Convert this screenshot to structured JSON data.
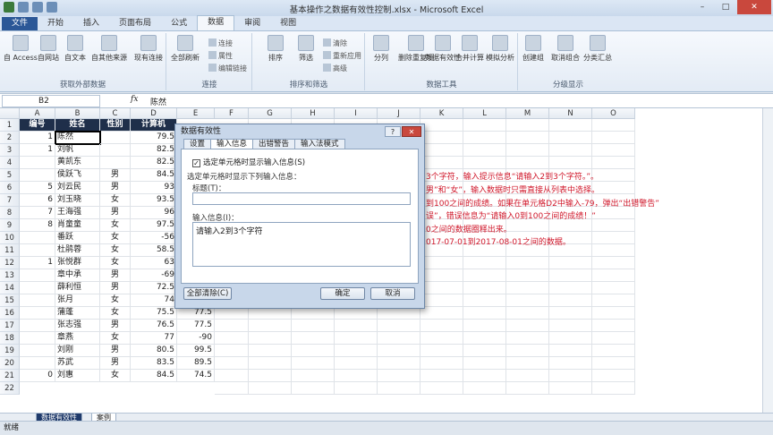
{
  "window": {
    "title": "基本操作之数据有效性控制.xlsx - Microsoft Excel",
    "min": "–",
    "max": "□",
    "close": "✕"
  },
  "tabs": [
    "文件",
    "开始",
    "插入",
    "页面布局",
    "公式",
    "数据",
    "审阅",
    "视图"
  ],
  "ribbon": {
    "groups": [
      {
        "label": "获取外部数据",
        "buttons": [
          "自 Access",
          "自网站",
          "自文本",
          "自其他来源",
          "现有连接"
        ]
      },
      {
        "label": "连接",
        "buttons": [
          "全部刷新"
        ],
        "small": [
          "连接",
          "属性",
          "编辑链接"
        ]
      },
      {
        "label": "排序和筛选",
        "buttons": [
          "排序",
          "筛选"
        ],
        "small": [
          "清除",
          "重新应用",
          "高级"
        ]
      },
      {
        "label": "数据工具",
        "buttons": [
          "分列",
          "删除重复项",
          "数据有效性",
          "合并计算",
          "模拟分析"
        ]
      },
      {
        "label": "分级显示",
        "buttons": [
          "创建组",
          "取消组合",
          "分类汇总"
        ]
      }
    ]
  },
  "formula_bar": {
    "name_box": "B2",
    "fx": "fx",
    "value": "陈然"
  },
  "columns": [
    "A",
    "B",
    "C",
    "D",
    "E",
    "F",
    "G",
    "H",
    "I",
    "J",
    "K",
    "L",
    "M",
    "N",
    "O"
  ],
  "header_row": [
    "编号",
    "姓名",
    "性别",
    "计算机"
  ],
  "rows": [
    {
      "n": "1",
      "name": "陈然",
      "sex": "",
      "score": "79.5",
      "e": ""
    },
    {
      "n": "1",
      "name": "刘帆",
      "sex": "",
      "score": "82.5",
      "e": ""
    },
    {
      "n": "",
      "name": "黄凯东",
      "sex": "",
      "score": "82.5",
      "e": ""
    },
    {
      "n": "",
      "name": "侯跃飞",
      "sex": "男",
      "score": "84.5",
      "e": ""
    },
    {
      "n": "5",
      "name": "刘云民",
      "sex": "男",
      "score": "93",
      "e": ""
    },
    {
      "n": "6",
      "name": "刘玉晓",
      "sex": "女",
      "score": "93.5",
      "e": ""
    },
    {
      "n": "7",
      "name": "王海强",
      "sex": "男",
      "score": "96",
      "e": ""
    },
    {
      "n": "8",
      "name": "肖童童",
      "sex": "女",
      "score": "97.5",
      "e": ""
    },
    {
      "n": "",
      "name": "番跃",
      "sex": "女",
      "score": "-56",
      "e": ""
    },
    {
      "n": "",
      "name": "杜鹃蓉",
      "sex": "女",
      "score": "58.5",
      "e": ""
    },
    {
      "n": "1",
      "name": "张悦群",
      "sex": "女",
      "score": "63",
      "e": ""
    },
    {
      "n": "",
      "name": "章中承",
      "sex": "男",
      "score": "-69",
      "e": ""
    },
    {
      "n": "",
      "name": "薛利恒",
      "sex": "男",
      "score": "72.5",
      "e": ""
    },
    {
      "n": "",
      "name": "张月",
      "sex": "女",
      "score": "74",
      "e": ""
    },
    {
      "n": "",
      "name": "蒲蓬",
      "sex": "女",
      "score": "75.5",
      "e": "77.5"
    },
    {
      "n": "",
      "name": "张志强",
      "sex": "男",
      "score": "76.5",
      "e": "77.5"
    },
    {
      "n": "",
      "name": "章燕",
      "sex": "女",
      "score": "77",
      "e": "-90"
    },
    {
      "n": "",
      "name": "刘刚",
      "sex": "男",
      "score": "80.5",
      "e": "99.5"
    },
    {
      "n": "",
      "name": "苏武",
      "sex": "男",
      "score": "83.5",
      "e": "89.5"
    },
    {
      "n": "0",
      "name": "刘惠",
      "sex": "女",
      "score": "84.5",
      "e": "74.5"
    }
  ],
  "instructions": [
    "3个字符，输入提示信息“请输入2到3个字符。”。",
    "男”和“女”，输入数据时只需直接从列表中选择。",
    "到100之间的成绩。如果在单元格D2中输入-79，弹出“出错警告”",
    "误”，错误信息为“请输入0到100之间的成绩！”",
    "0之间的数据圈释出来。",
    "017-07-01到2017-08-01之间的数据。"
  ],
  "dialog": {
    "title": "数据有效性",
    "help": "?",
    "close": "✕",
    "tabs": [
      "设置",
      "输入信息",
      "出错警告",
      "输入法模式"
    ],
    "checkbox_label": "选定单元格时显示输入信息(S)",
    "checkbox_mark": "✓",
    "subheading": "选定单元格时显示下列输入信息：",
    "title_label": "标题(T)：",
    "title_value": "",
    "message_label": "输入信息(I)：",
    "message_value": "请输入2到3个字符",
    "clear_button": "全部清除(C)",
    "ok_button": "确定",
    "cancel_button": "取消"
  },
  "sheets": [
    "数据有效性",
    "案例"
  ],
  "status": "就绪"
}
